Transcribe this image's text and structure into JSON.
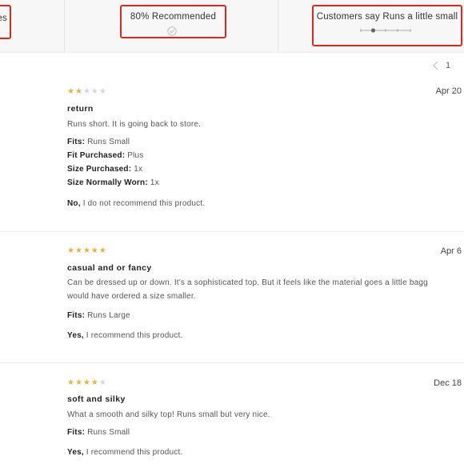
{
  "summary": {
    "left_label": "es",
    "recommended": "80% Recommended",
    "fit_label": "Customers say Runs a little small",
    "fit_position": 0.25
  },
  "pager": {
    "page": "1"
  },
  "colors": {
    "star": "#e4b33c",
    "highlight_box": "#d9291c"
  },
  "reviews": [
    {
      "stars": 2,
      "date": "Apr 20",
      "title": "return",
      "text": [
        "Runs short. It is going back to store."
      ],
      "fits_label": "Fits:",
      "fits": "Runs Small",
      "fit_purchased_label": "Fit Purchased:",
      "fit_purchased": "Plus",
      "size_purchased_label": "Size Purchased:",
      "size_purchased": "1x",
      "size_worn_label": "Size Normally Worn:",
      "size_worn": "1x",
      "rec_bold": "No,",
      "rec_text": " I do not recommend this product."
    },
    {
      "stars": 5,
      "date": "Apr 6",
      "title": "casual and or fancy",
      "text": [
        "Can be dressed up or down. It's a sophisticated top. But it feels like the material goes a little bagg",
        "would have ordered a size smaller."
      ],
      "fits_label": "Fits:",
      "fits": "Runs Large",
      "rec_bold": "Yes,",
      "rec_text": " I recommend this product."
    },
    {
      "stars": 4,
      "date": "Dec 18",
      "title": "soft and silky",
      "text": [
        "What a smooth and silky top! Runs small but very nice."
      ],
      "fits_label": "Fits:",
      "fits": "Runs Small",
      "rec_bold": "Yes,",
      "rec_text": " I recommend this product."
    }
  ]
}
